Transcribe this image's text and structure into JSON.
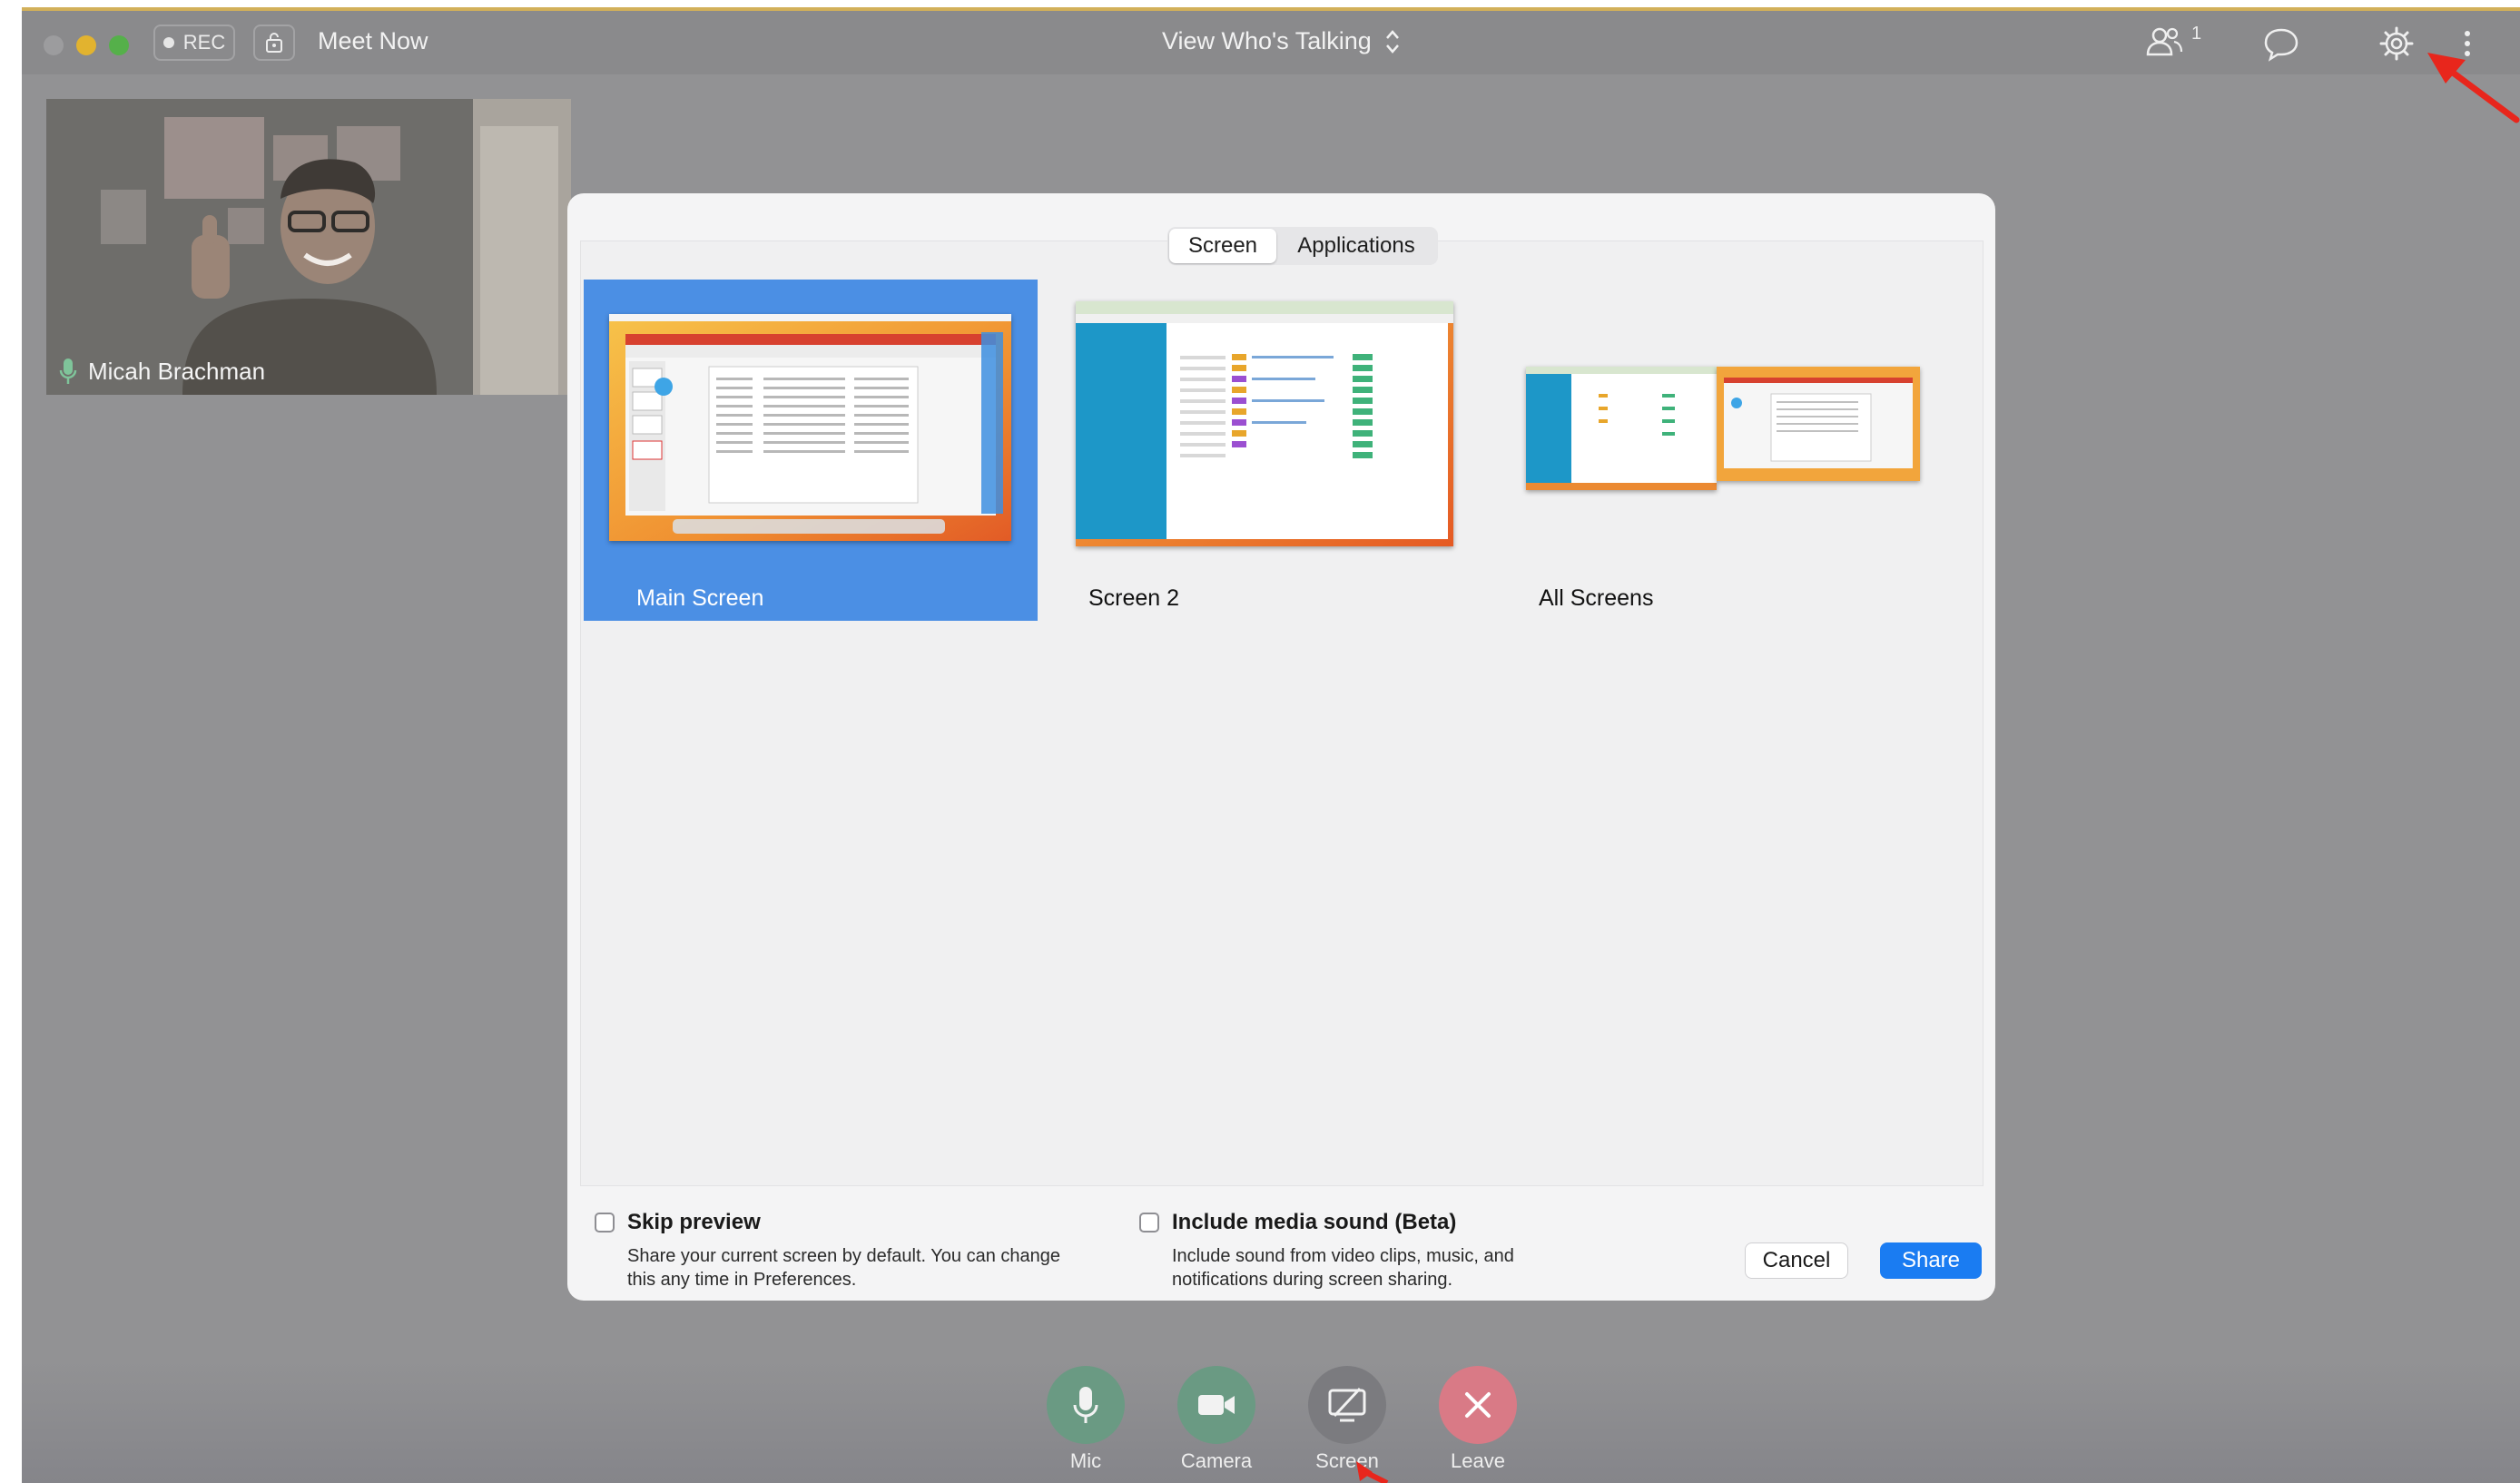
{
  "titlebar": {
    "rec_label": "REC",
    "meeting_title": "Meet Now",
    "view_mode": "View Who's Talking",
    "participants_count": "1"
  },
  "video": {
    "participant_name": "Micah Brachman"
  },
  "dialog": {
    "tabs": [
      {
        "label": "Screen",
        "active": true
      },
      {
        "label": "Applications",
        "active": false
      }
    ],
    "screens": [
      {
        "label": "Main Screen",
        "selected": true
      },
      {
        "label": "Screen 2",
        "selected": false
      },
      {
        "label": "All Screens",
        "selected": false
      }
    ],
    "skip_preview": {
      "label": "Skip preview",
      "checked": false,
      "description_line1": "Share your current screen by default. You can change",
      "description_line2": "this any time in Preferences."
    },
    "media_sound": {
      "label": "Include media sound (Beta)",
      "checked": false,
      "description_line1": "Include sound from video clips, music, and",
      "description_line2": "notifications during screen sharing."
    },
    "cancel_label": "Cancel",
    "share_label": "Share"
  },
  "controls": {
    "mic_label": "Mic",
    "camera_label": "Camera",
    "screen_label": "Screen",
    "leave_label": "Leave"
  },
  "colors": {
    "accent_blue": "#1a7cf2",
    "selected_card": "#4b8fe4",
    "annotation_red": "#e8261c",
    "mic_green": "#6a9a83",
    "leave_red": "#d97a86"
  }
}
